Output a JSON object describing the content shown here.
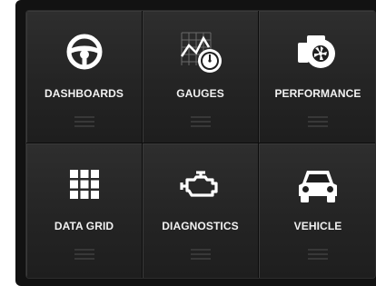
{
  "menu": {
    "tiles": [
      {
        "label": "DASHBOARDS",
        "icon": "steering-wheel-icon"
      },
      {
        "label": "GAUGES",
        "icon": "gauge-chart-icon"
      },
      {
        "label": "PERFORMANCE",
        "icon": "turbocharger-icon"
      },
      {
        "label": "DATA GRID",
        "icon": "data-grid-icon"
      },
      {
        "label": "DIAGNOSTICS",
        "icon": "check-engine-icon"
      },
      {
        "label": "VEHICLE",
        "icon": "car-icon"
      }
    ]
  },
  "colors": {
    "tile_bg": "#2e2e2e",
    "label_text": "#f2f2f2",
    "icon": "#ffffff"
  }
}
